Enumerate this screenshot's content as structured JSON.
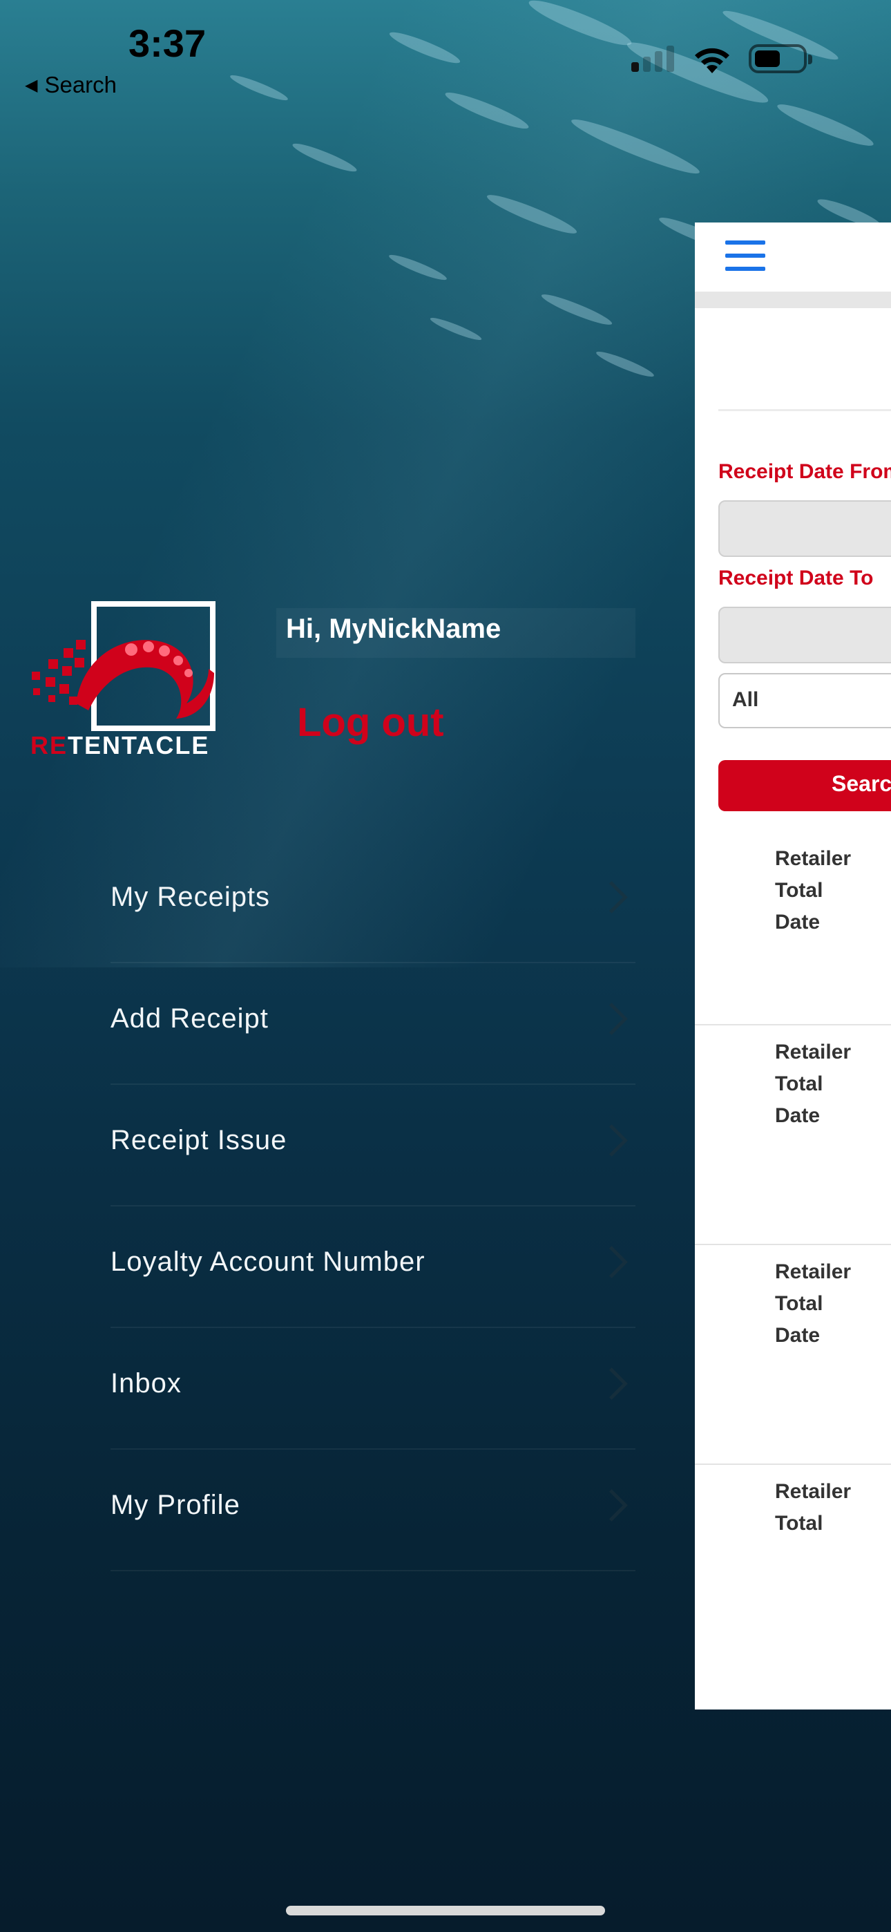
{
  "status_bar": {
    "time": "3:37",
    "back_label": "Search",
    "back_arrow": "◀"
  },
  "profile": {
    "greeting": "Hi, MyNickName",
    "logout_label": "Log out",
    "logo_re": "RE",
    "logo_rest": "TENTACLE"
  },
  "menu": {
    "items": [
      {
        "label": "My Receipts"
      },
      {
        "label": "Add Receipt"
      },
      {
        "label": "Receipt Issue"
      },
      {
        "label": "Loyalty Account Number"
      },
      {
        "label": "Inbox"
      },
      {
        "label": "My Profile"
      }
    ]
  },
  "main": {
    "date_from_label": "Receipt Date From",
    "date_to_label": "Receipt Date To",
    "filter_value": "All",
    "search_label": "Search",
    "cards": [
      {
        "retailer": "Retailer",
        "total": "Total",
        "date": "Date"
      },
      {
        "retailer": "Retailer",
        "total": "Total",
        "date": "Date"
      },
      {
        "retailer": "Retailer",
        "total": "Total",
        "date": "Date"
      },
      {
        "retailer": "Retailer",
        "total": "Total"
      }
    ]
  },
  "colors": {
    "brand_red": "#d0021b",
    "accent_blue": "#1a73e8",
    "background_ocean": "#0d3c54"
  }
}
